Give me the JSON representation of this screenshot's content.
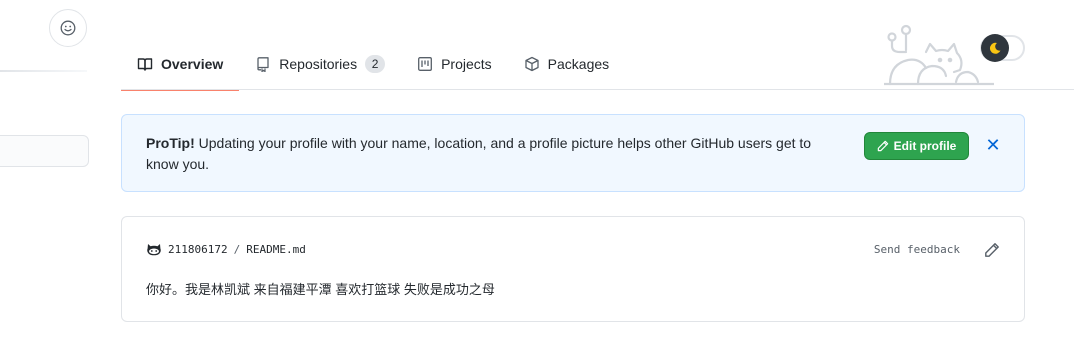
{
  "tabs": [
    {
      "label": "Overview",
      "icon": "book-icon",
      "active": true
    },
    {
      "label": "Repositories",
      "icon": "repo-icon",
      "count": "2"
    },
    {
      "label": "Projects",
      "icon": "project-icon"
    },
    {
      "label": "Packages",
      "icon": "package-icon"
    }
  ],
  "protip": {
    "title": "ProTip!",
    "message": " Updating your profile with your name, location, and a profile picture helps other GitHub users get to know you.",
    "edit_label": "Edit profile",
    "close_symbol": "✕"
  },
  "readme": {
    "user": "211806172",
    "separator": "/",
    "file": "README.md",
    "feedback_label": "Send feedback",
    "content": "你好。我是林凯斌 来自福建平潭 喜欢打篮球 失败是成功之母"
  },
  "colors": {
    "accent_tab": "#f9826c",
    "success": "#2ea44f",
    "link": "#0366d6",
    "banner_bg": "#f1f8ff"
  }
}
